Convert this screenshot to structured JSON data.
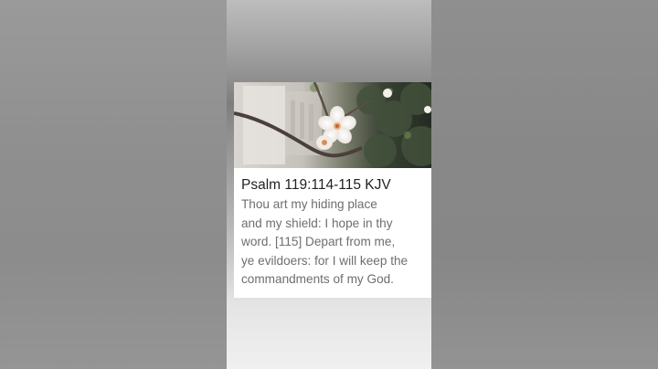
{
  "verse": {
    "reference": "Psalm 119:114-115 KJV",
    "lines": [
      "Thou art my hiding place",
      "and my shield: I hope in thy",
      "word. [115] Depart from me,",
      "ye evildoers: for I will keep the",
      "commandments of my God."
    ]
  },
  "image": {
    "subject": "white blossom on branch",
    "colors": {
      "blossom": "#f4efea",
      "foliage": "#2f3a2c",
      "background": "#c9c5bf"
    }
  }
}
